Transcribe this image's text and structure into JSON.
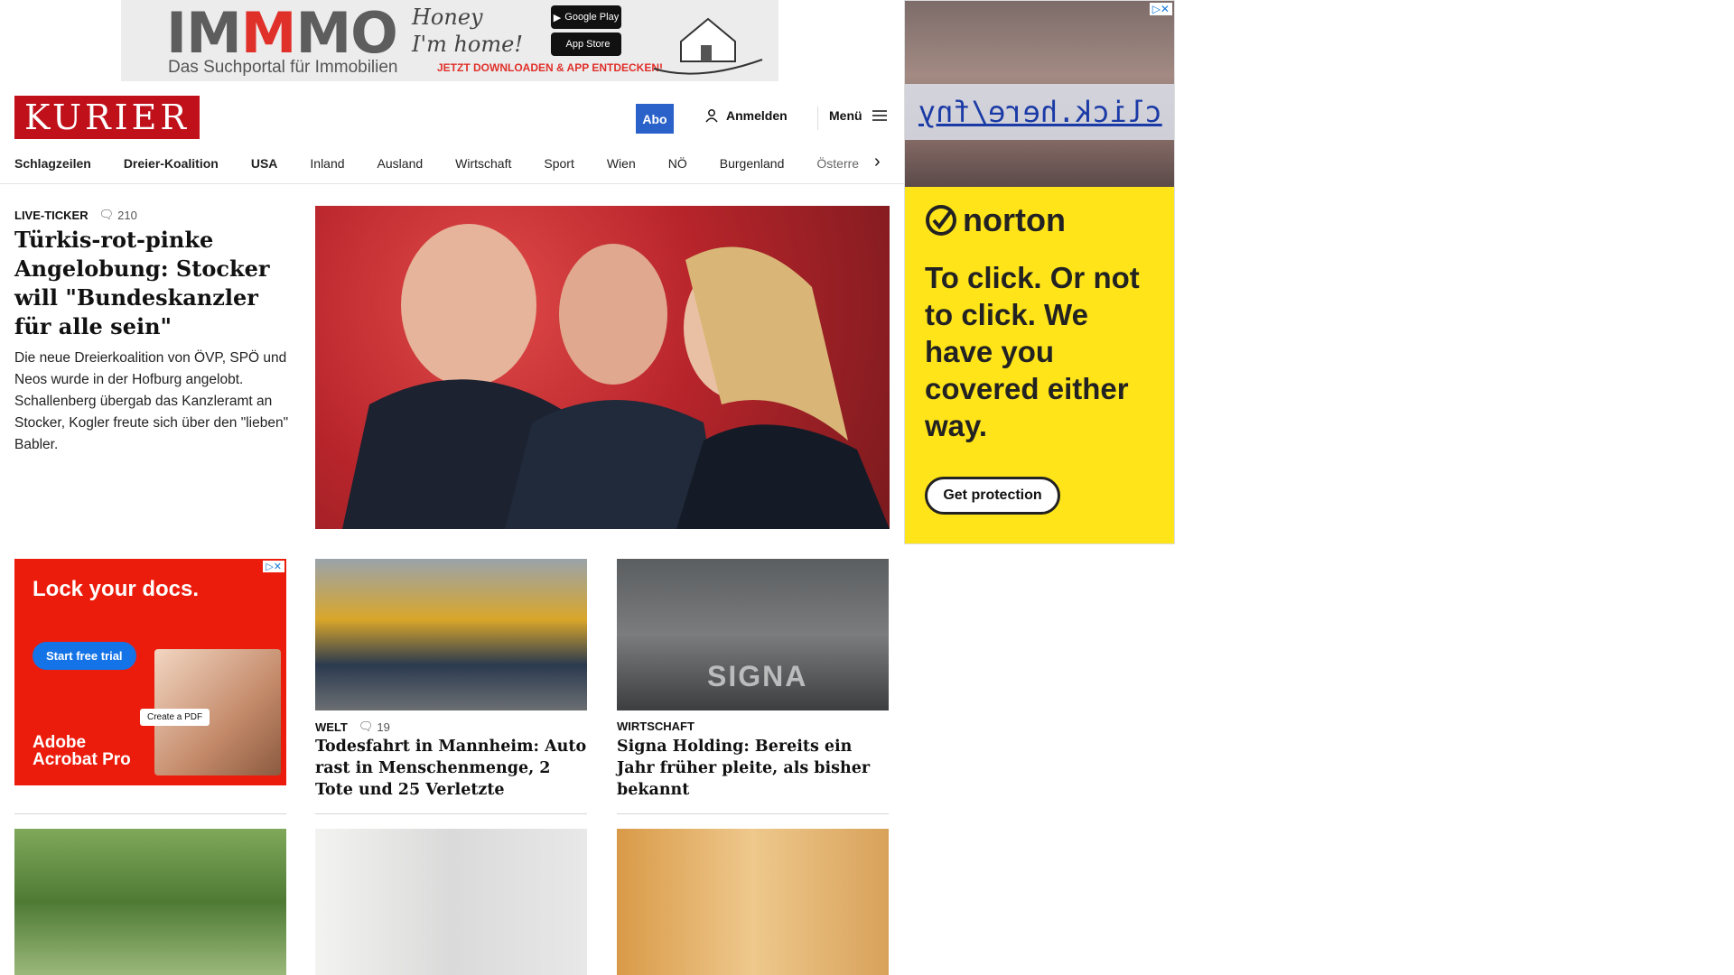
{
  "top_ad": {
    "brand_prefix": "IM",
    "brand_mid": "M",
    "brand_suffix": "MO",
    "tagline": "Das Suchportal für Immobilien",
    "script_line1": "Honey",
    "script_line2": "I'm home!",
    "google_play": "Google Play",
    "app_store": "App Store",
    "cta": "JETZT DOWNLOADEN & APP ENTDECKEN!"
  },
  "right_ad": {
    "clickbait": "click.here/fny",
    "brand": "norton",
    "headline": "To click. Or not to click. We have you covered either way.",
    "button": "Get protection"
  },
  "header": {
    "logo": "KURIER",
    "abo": "Abo",
    "login": "Anmelden",
    "menu": "Menü"
  },
  "nav": {
    "items": [
      "Schlagzeilen",
      "Dreier-Koalition",
      "USA",
      "Inland",
      "Ausland",
      "Wirtschaft",
      "Sport",
      "Wien",
      "NÖ",
      "Burgenland",
      "Österre"
    ]
  },
  "lead": {
    "kicker": "LIVE-TICKER",
    "comments": "210",
    "title": "Türkis-rot-pinke Angelobung: Stocker will \"Bundeskanzler für alle sein\"",
    "teaser": "Die neue Dreierkoalition von ÖVP, SPÖ und Neos wurde in der Hofburg angelobt. Schallenberg übergab das Kanzleramt an Stocker, Kogler freute sich über den \"lieben\" Babler."
  },
  "ad_adobe": {
    "headline": "Lock your docs.",
    "button": "Start free trial",
    "pdf_chip": "Create a PDF",
    "brand_line1": "Adobe",
    "brand_line2": "Acrobat Pro"
  },
  "articles": [
    {
      "kicker": "WELT",
      "comments": "19",
      "title": "Todesfahrt in Mannheim: Auto rast in Menschenmenge, 2 Tote und 25 Verletzte"
    },
    {
      "kicker": "WIRTSCHAFT",
      "title": "Signa Holding: Bereits ein Jahr früher pleite, als bisher bekannt",
      "image_text": "SIGNA"
    }
  ],
  "colors": {
    "brand_red": "#c0101a",
    "abo_blue": "#2a62c9",
    "norton_yellow": "#ffe41a",
    "adobe_red": "#ec1c0c"
  }
}
